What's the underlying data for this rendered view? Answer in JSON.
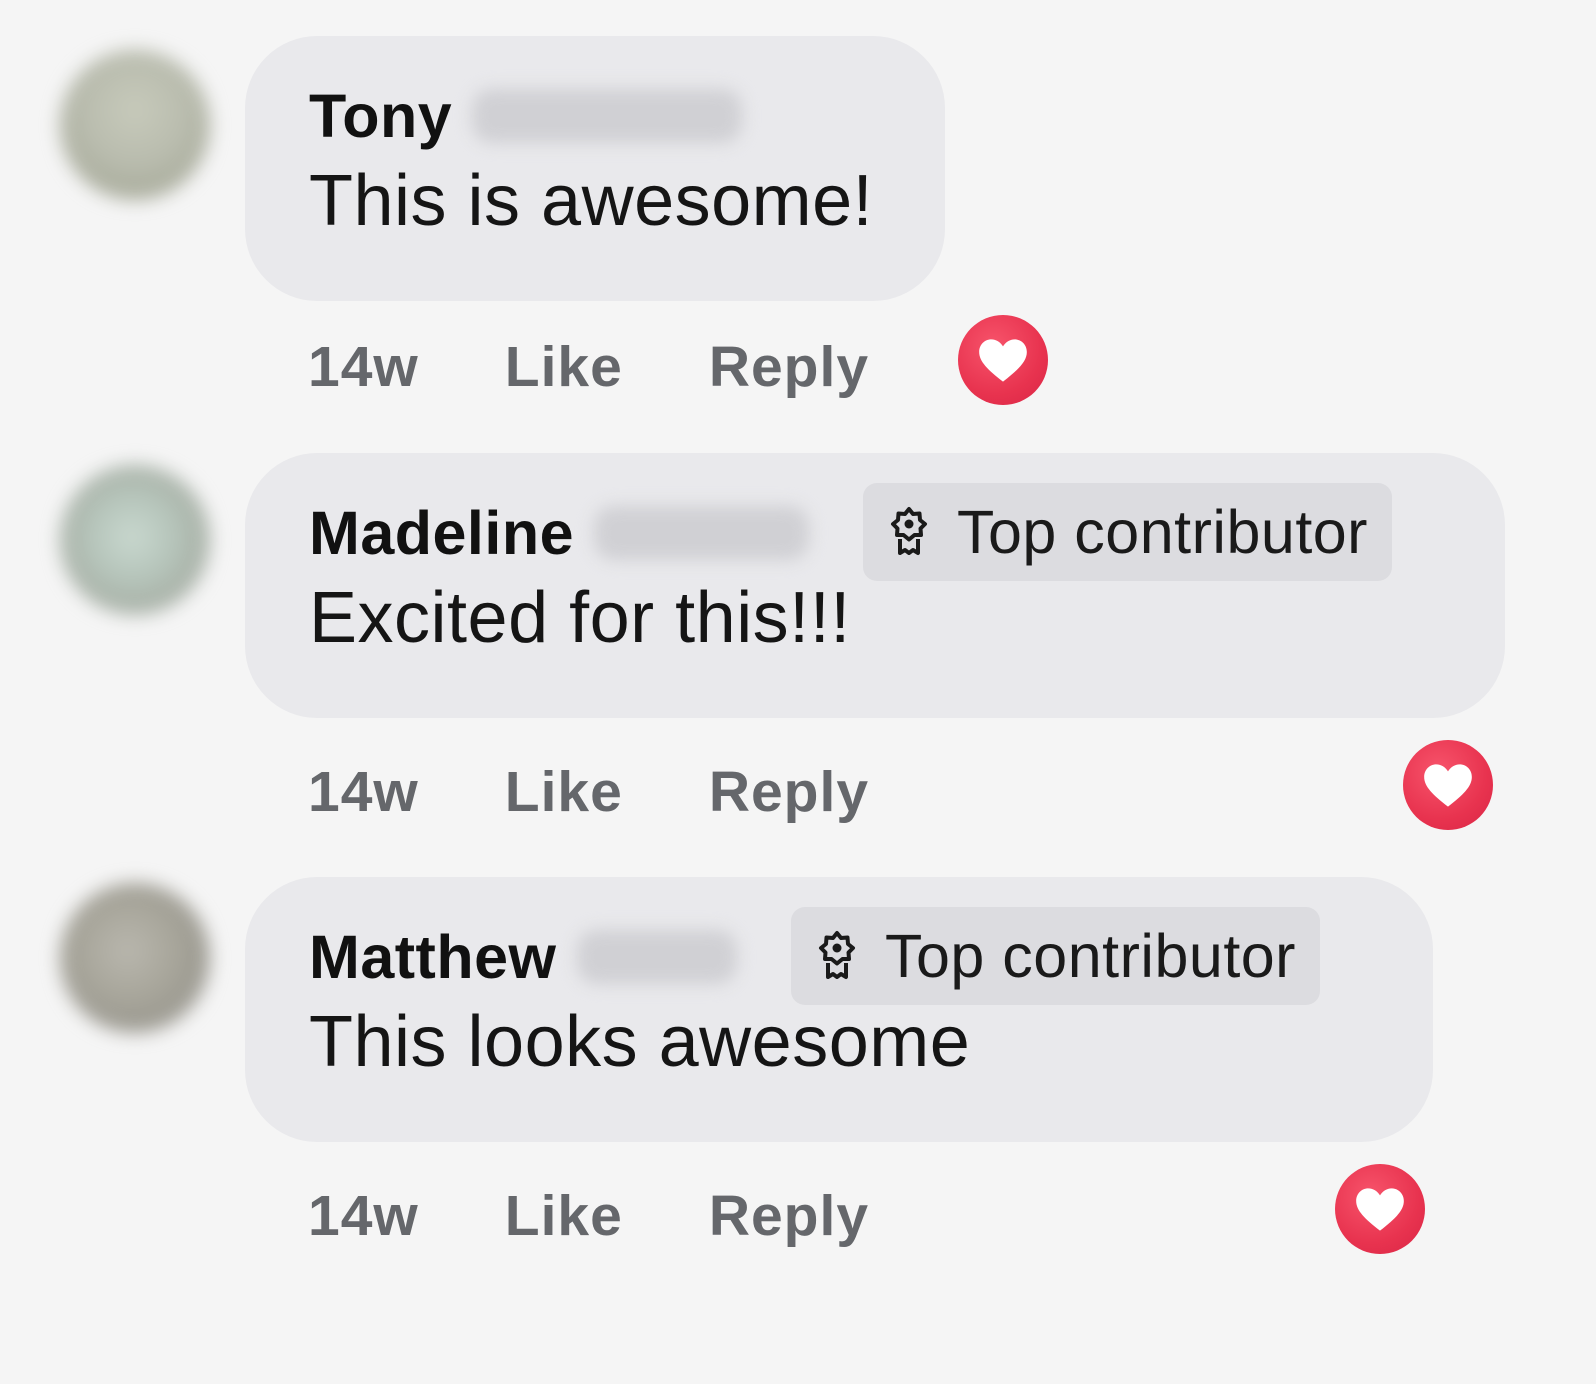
{
  "comments": [
    {
      "author_first": "Tony",
      "badge": "",
      "text": "This is awesome!",
      "time": "14w",
      "like_label": "Like",
      "reply_label": "Reply",
      "reaction_icon": "heart-reaction-icon"
    },
    {
      "author_first": "Madeline",
      "badge": "Top contributor",
      "text": "Excited for this!!!",
      "time": "14w",
      "like_label": "Like",
      "reply_label": "Reply",
      "reaction_icon": "heart-reaction-icon"
    },
    {
      "author_first": "Matthew",
      "badge": "Top contributor",
      "text": "This looks awesome",
      "time": "14w",
      "like_label": "Like",
      "reply_label": "Reply",
      "reaction_icon": "heart-reaction-icon"
    }
  ],
  "colors": {
    "bubble": "#e9e9ec",
    "badge": "#dcdce0",
    "reaction": "#e8334f",
    "action_text": "#65676b"
  }
}
